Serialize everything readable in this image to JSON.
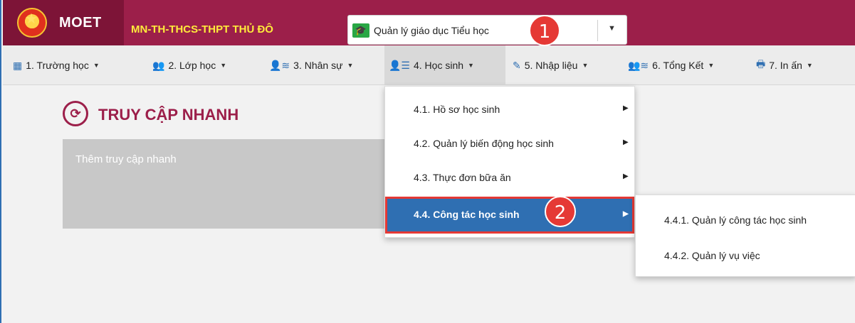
{
  "header": {
    "brand": "MOET",
    "school": "MN-TH-THCS-THPT THỦ ĐÔ",
    "module_select": {
      "value": "Quản lý giáo dục Tiểu học"
    },
    "colors": {
      "header_bg": "#9c1f4a",
      "brand_bg": "#7d1437",
      "school_text": "#ffeb3b"
    }
  },
  "badges": {
    "step1": "1",
    "step2": "2"
  },
  "nav": {
    "items": [
      {
        "label": "1. Trường học",
        "icon": "building-icon"
      },
      {
        "label": "2. Lớp học",
        "icon": "class-group-icon"
      },
      {
        "label": "3. Nhân sự",
        "icon": "staff-icon"
      },
      {
        "label": "4. Học sinh",
        "icon": "student-list-icon"
      },
      {
        "label": "5. Nhập liệu",
        "icon": "edit-icon"
      },
      {
        "label": "6. Tổng Kết",
        "icon": "summary-icon"
      },
      {
        "label": "7. In ấn",
        "icon": "printer-icon"
      }
    ]
  },
  "quick_access": {
    "title": "TRUY CẬP NHANH",
    "add_label": "Thêm truy cập nhanh"
  },
  "student_menu": {
    "items": [
      {
        "label": "4.1. Hồ sơ học sinh"
      },
      {
        "label": "4.2. Quản lý biến động học sinh"
      },
      {
        "label": "4.3. Thực đơn bữa ăn"
      },
      {
        "label": "4.4. Công tác học sinh"
      }
    ],
    "active_color": "#2f6fb2"
  },
  "student_work_submenu": {
    "items": [
      {
        "label": "4.4.1. Quản lý công tác học sinh"
      },
      {
        "label": "4.4.2. Quản lý vụ việc"
      }
    ]
  }
}
